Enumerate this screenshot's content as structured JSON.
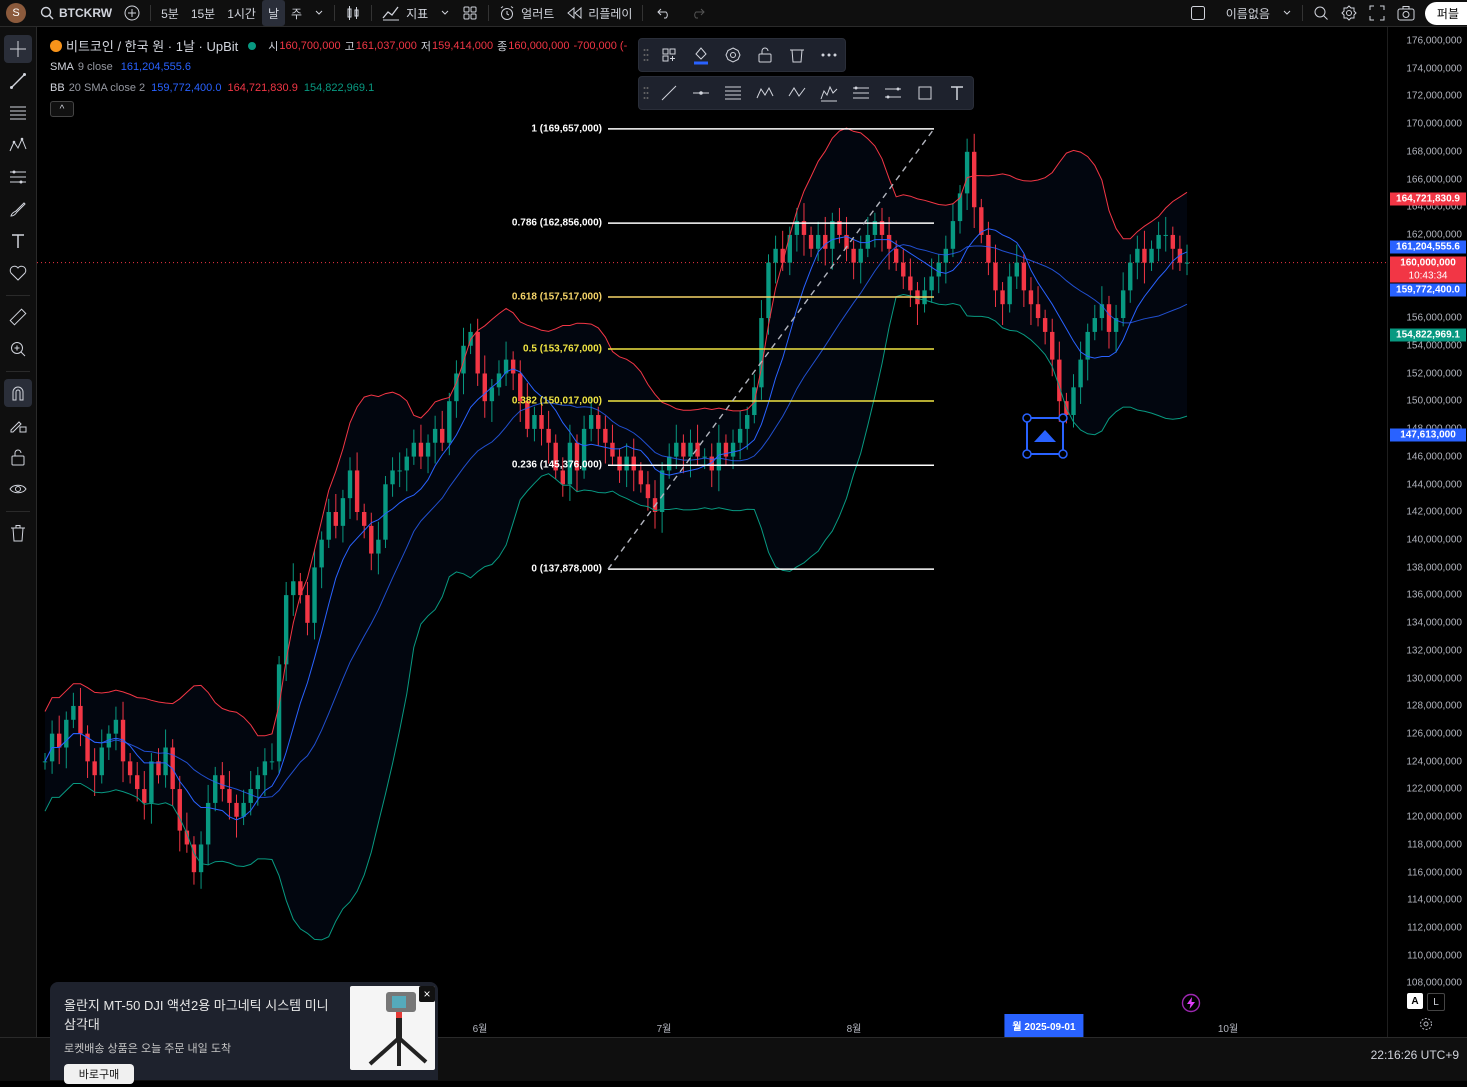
{
  "topbar": {
    "avatar": "S",
    "symbol": "BTCKRW",
    "intervals": [
      "5분",
      "15분",
      "1시간",
      "날",
      "주"
    ],
    "indicators": "지표",
    "alert": "얼러트",
    "replay": "리플레이",
    "layout_name": "이름없음",
    "publish": "퍼블"
  },
  "legend": {
    "symbol_name": "비트코인 / 한국 원 · 1날 · UpBit",
    "open_label": "시",
    "open": "160,700,000",
    "high_label": "고",
    "high": "161,037,000",
    "low_label": "저",
    "low": "159,414,000",
    "close_label": "종",
    "close": "160,000,000",
    "change": "-700,000 (-",
    "sma_name": "SMA",
    "sma_params": "9 close",
    "sma_value": "161,204,555.6",
    "bb_name": "BB",
    "bb_params": "20 SMA close 2",
    "bb_basis": "159,772,400.0",
    "bb_upper": "164,721,830.9",
    "bb_lower": "154,822,969.1",
    "collapse": "^"
  },
  "price_axis": {
    "labels": [
      "176,000,000",
      "174,000,000",
      "172,000,000",
      "170,000,000",
      "168,000,000",
      "166,000,000",
      "164,000,000",
      "162,000,000",
      "160,000,000",
      "158,000,000",
      "156,000,000",
      "154,000,000",
      "152,000,000",
      "150,000,000",
      "148,000,000",
      "146,000,000",
      "144,000,000",
      "142,000,000",
      "140,000,000",
      "138,000,000",
      "136,000,000",
      "134,000,000",
      "132,000,000",
      "130,000,000",
      "128,000,000",
      "126,000,000",
      "124,000,000",
      "122,000,000",
      "120,000,000",
      "118,000,000",
      "116,000,000",
      "114,000,000",
      "112,000,000",
      "110,000,000",
      "108,000,000"
    ],
    "badges": {
      "bb_upper": "164,721,830.9",
      "sma": "161,204,555.6",
      "last": "160,000,000",
      "countdown": "10:43:34",
      "bb_basis": "159,772,400.0",
      "bb_lower": "154,822,969.1",
      "cursor": "147,613,000"
    },
    "auto": "A",
    "log": "L"
  },
  "time_axis": {
    "labels": [
      "6월",
      "7월",
      "8월",
      "10월"
    ],
    "highlight": "월 2025-09-01"
  },
  "fib": {
    "levels": [
      {
        "ratio": "1",
        "price": "169,657,000",
        "color": "#ffffff"
      },
      {
        "ratio": "0.786",
        "price": "162,856,000",
        "color": "#ffffff"
      },
      {
        "ratio": "0.618",
        "price": "157,517,000",
        "color": "#f5d469"
      },
      {
        "ratio": "0.5",
        "price": "153,767,000",
        "color": "#f0e442"
      },
      {
        "ratio": "0.382",
        "price": "150,017,000",
        "color": "#f0e442"
      },
      {
        "ratio": "0.236",
        "price": "145,376,000",
        "color": "#ffffff"
      },
      {
        "ratio": "0",
        "price": "137,878,000",
        "color": "#ffffff"
      }
    ]
  },
  "bottom": {
    "clock": "22:16:26 UTC+9"
  },
  "ad": {
    "title": "올란지 MT-50 DJI 액션2용 마그네틱 시스템 미니 삼각대",
    "subtitle": "로켓배송 상품은 오늘 주문 내일 도착",
    "button": "바로구매",
    "close": "×"
  },
  "colors": {
    "up": "#089981",
    "down": "#f23645",
    "bb_upper": "#f23645",
    "bb_lower": "#089981",
    "sma": "#2962ff",
    "bb_basis": "#2962ff",
    "accent": "#2962ff"
  },
  "chart_data": {
    "type": "candlestick",
    "title": "비트코인 / 한국 원 · 1날 · UpBit",
    "ylim": [
      107000000,
      177000000
    ],
    "x_months": [
      "6월",
      "7월",
      "8월",
      "2025-09-01",
      "10월"
    ],
    "close_series": [
      124,
      126,
      125,
      127,
      128,
      126,
      124,
      123,
      125,
      126,
      127,
      124,
      123,
      122,
      121,
      124,
      123,
      125,
      122,
      119,
      118,
      116,
      118,
      121,
      123,
      122,
      121,
      120,
      121,
      122,
      123,
      124,
      124,
      131,
      136,
      137,
      136,
      134,
      138,
      140,
      142,
      141,
      143,
      145,
      142,
      141,
      139,
      140,
      144,
      145,
      145,
      146,
      147,
      146,
      147,
      148,
      147,
      150,
      152,
      154,
      155,
      152,
      150,
      151,
      152,
      153,
      152,
      150,
      148,
      149,
      148,
      147,
      145,
      144,
      147,
      145,
      148,
      149,
      148,
      147,
      146,
      145,
      146,
      145,
      144,
      143,
      142,
      145,
      146,
      147,
      146,
      147,
      146,
      146,
      145,
      147,
      146,
      147,
      148,
      149,
      151,
      156,
      160,
      161,
      160,
      162,
      163,
      162,
      161,
      162,
      161,
      163,
      162,
      161,
      160,
      161,
      162,
      163,
      162,
      161,
      160,
      159,
      158,
      157,
      158,
      159,
      160,
      161,
      163,
      165,
      168,
      164,
      162,
      160,
      158,
      157,
      159,
      160,
      158,
      157,
      156,
      155,
      153,
      150,
      149,
      151,
      153,
      155,
      156,
      157,
      155,
      156,
      158,
      160,
      161,
      160,
      161,
      162,
      162,
      161,
      160,
      160
    ]
  }
}
